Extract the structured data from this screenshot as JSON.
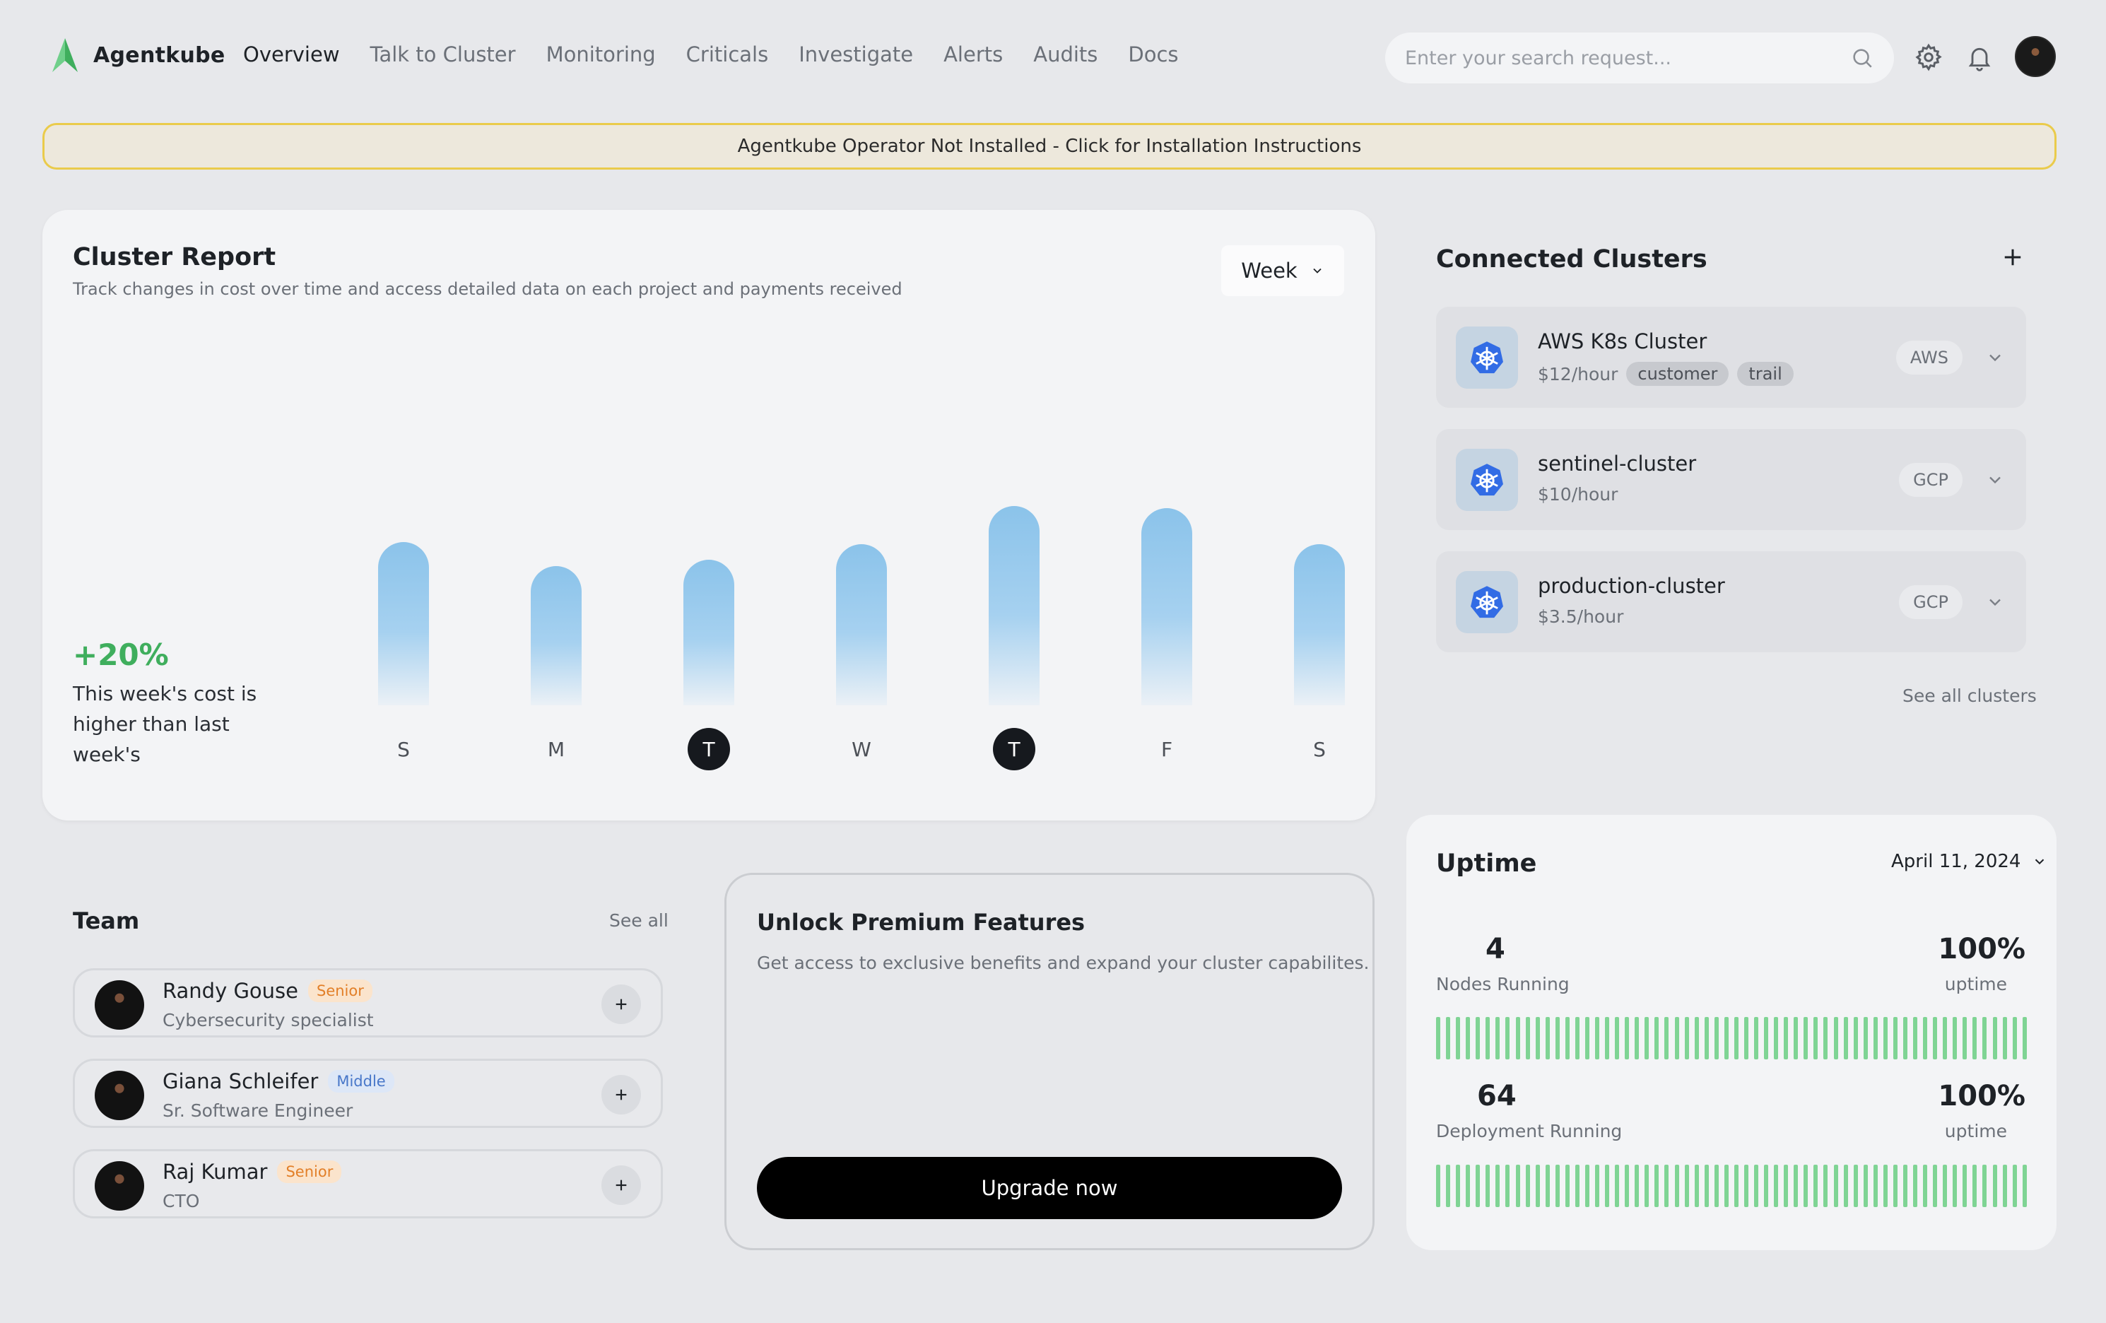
{
  "app": {
    "name": "Agentkube",
    "accent": "#3fae5d"
  },
  "nav": {
    "items": [
      "Overview",
      "Talk to Cluster",
      "Monitoring",
      "Criticals",
      "Investigate",
      "Alerts",
      "Audits",
      "Docs"
    ],
    "active": "Overview"
  },
  "search": {
    "placeholder": "Enter your search request..."
  },
  "banner": {
    "text": "Agentkube Operator Not Installed - Click for Installation Instructions",
    "border_color": "#eacb4b"
  },
  "report": {
    "title": "Cluster Report",
    "subtitle": "Track changes in cost over time and access detailed data on each project and payments received",
    "period": "Week",
    "change": "+20%",
    "change_desc": "This week's cost is higher than last week's"
  },
  "chart_data": {
    "type": "bar",
    "categories": [
      "S",
      "M",
      "T",
      "W",
      "T",
      "F",
      "S"
    ],
    "values": [
      0.82,
      0.7,
      0.73,
      0.81,
      1.0,
      0.99,
      0.81
    ],
    "highlighted": [
      2,
      4
    ]
  },
  "clusters": {
    "title": "Connected Clusters",
    "items": [
      {
        "name": "AWS K8s Cluster",
        "price": "$12/hour",
        "tags": [
          "customer",
          "trail"
        ],
        "provider": "AWS"
      },
      {
        "name": "sentinel-cluster",
        "price": "$10/hour",
        "tags": [],
        "provider": "GCP"
      },
      {
        "name": "production-cluster",
        "price": "$3.5/hour",
        "tags": [],
        "provider": "GCP"
      }
    ],
    "see_all": "See all clusters"
  },
  "uptime": {
    "title": "Uptime",
    "date": "April 11, 2024",
    "rows": [
      {
        "count": "4",
        "label": "Nodes Running",
        "percent": "100%",
        "percent_label": "uptime"
      },
      {
        "count": "64",
        "label": "Deployment Running",
        "percent": "100%",
        "percent_label": "uptime"
      }
    ],
    "bar_color": "#7fd494"
  },
  "team": {
    "title": "Team",
    "see_all": "See all",
    "members": [
      {
        "name": "Randy Gouse",
        "level": "Senior",
        "role": "Cybersecurity specialist"
      },
      {
        "name": "Giana Schleifer",
        "level": "Middle",
        "role": "Sr. Software Engineer"
      },
      {
        "name": "Raj Kumar",
        "level": "Senior",
        "role": "CTO"
      }
    ]
  },
  "premium": {
    "title": "Unlock Premium Features",
    "subtitle": "Get access to exclusive benefits and expand your cluster capabilites.",
    "button": "Upgrade now"
  }
}
